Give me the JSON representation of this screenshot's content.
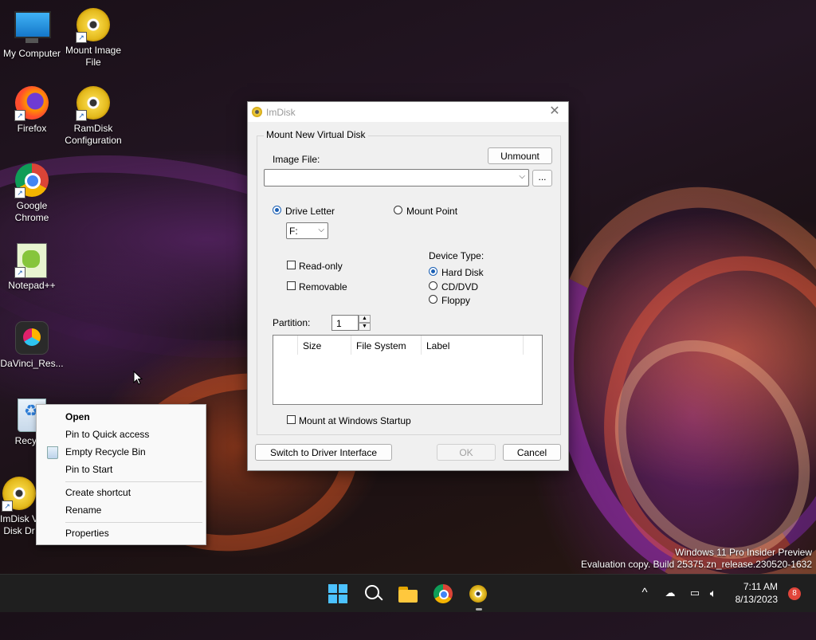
{
  "desktop": {
    "icons": [
      {
        "label": "My Computer",
        "icon": "computer-icon"
      },
      {
        "label": "Mount Image File",
        "icon": "cd-disc-icon"
      },
      {
        "label": "Firefox",
        "icon": "firefox-icon"
      },
      {
        "label": "RamDisk Configuration",
        "icon": "cd-disc-icon"
      },
      {
        "label": "Google Chrome",
        "icon": "chrome-icon"
      },
      {
        "label": "Notepad++",
        "icon": "notepad-icon"
      },
      {
        "label": "DaVinci_Res...",
        "icon": "davinci-icon"
      },
      {
        "label": "Recycle",
        "icon": "recycle-bin-icon"
      },
      {
        "label": "ImDisk V Disk Dr",
        "icon": "cd-disc-icon"
      }
    ]
  },
  "dialog": {
    "title": "ImDisk",
    "group_title": "Mount New Virtual Disk",
    "image_file_label": "Image File:",
    "unmount_label": "Unmount",
    "image_file_value": "",
    "browse_label": "...",
    "drive_letter_label": "Drive Letter",
    "mount_point_label": "Mount Point",
    "drive_letter_value": "F:",
    "readonly_label": "Read-only",
    "removable_label": "Removable",
    "device_type_label": "Device Type:",
    "hard_disk_label": "Hard Disk",
    "cddvd_label": "CD/DVD",
    "floppy_label": "Floppy",
    "partition_label": "Partition:",
    "partition_value": "1",
    "columns": [
      "Size",
      "File System",
      "Label"
    ],
    "mount_startup_label": "Mount at Windows Startup",
    "switch_driver_label": "Switch to Driver Interface",
    "ok_label": "OK",
    "cancel_label": "Cancel"
  },
  "context_menu": {
    "items": [
      "Open",
      "Pin to Quick access",
      "Empty Recycle Bin",
      "Pin to Start",
      "Create shortcut",
      "Rename",
      "Properties"
    ]
  },
  "watermark": {
    "line1": "Windows 11 Pro Insider Preview",
    "line2": "Evaluation copy. Build 25375.zn_release.230520-1632"
  },
  "taskbar": {
    "time": "7:11 AM",
    "date": "8/13/2023",
    "notification_count": "8",
    "chevron": "^"
  },
  "colors": {
    "accent": "#1a5fb4",
    "taskbar_bg": "#1f1f1f",
    "dialog_bg": "#f0f0f0"
  }
}
